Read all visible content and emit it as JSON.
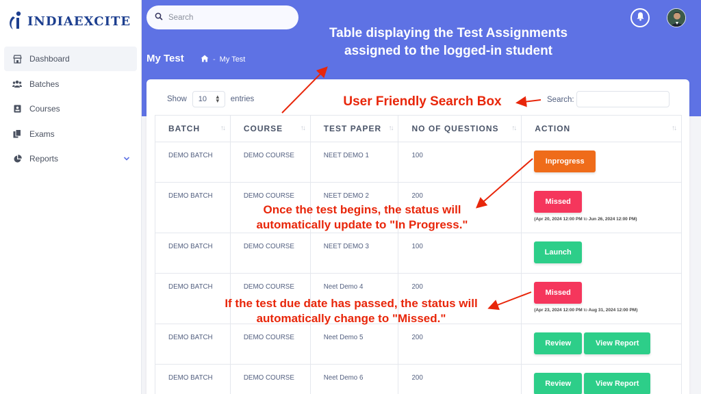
{
  "brand": {
    "name": "INDIAEXCITE"
  },
  "sidebar": {
    "items": [
      {
        "label": "Dashboard",
        "icon": "store-icon"
      },
      {
        "label": "Batches",
        "icon": "users-icon"
      },
      {
        "label": "Courses",
        "icon": "contact-card-icon"
      },
      {
        "label": "Exams",
        "icon": "copy-icon"
      },
      {
        "label": "Reports",
        "icon": "pie-chart-icon"
      }
    ]
  },
  "header": {
    "search_placeholder": "Search",
    "page_title": "My Test",
    "breadcrumb_current": "My Test"
  },
  "table_controls": {
    "show_label": "Show",
    "entries_value": "10",
    "entries_label": "entries",
    "search_label": "Search:"
  },
  "table": {
    "columns": [
      "BATCH",
      "COURSE",
      "TEST PAPER",
      "NO OF QUESTIONS",
      "ACTION"
    ],
    "rows": [
      {
        "batch": "DEMO BATCH",
        "course": "DEMO COURSE",
        "paper": "NEET DEMO 1",
        "questions": "100",
        "actions": [
          "Inprogress"
        ],
        "dates": null
      },
      {
        "batch": "DEMO BATCH",
        "course": "DEMO COURSE",
        "paper": "NEET DEMO 2",
        "questions": "200",
        "actions": [
          "Missed"
        ],
        "dates": {
          "from": "(Apr 20, 2024 12:00 PM",
          "to_word": "to",
          "to": "Jun 26, 2024 12:00 PM)"
        }
      },
      {
        "batch": "DEMO BATCH",
        "course": "DEMO COURSE",
        "paper": "NEET DEMO 3",
        "questions": "100",
        "actions": [
          "Launch"
        ],
        "dates": null
      },
      {
        "batch": "DEMO BATCH",
        "course": "DEMO COURSE",
        "paper": "Neet Demo 4",
        "questions": "200",
        "actions": [
          "Missed"
        ],
        "dates": {
          "from": "(Apr 23, 2024 12:00 PM",
          "to_word": "to",
          "to": "Aug 31, 2024 12:00 PM)"
        }
      },
      {
        "batch": "DEMO BATCH",
        "course": "DEMO COURSE",
        "paper": "Neet Demo 5",
        "questions": "200",
        "actions": [
          "Review",
          "View Report"
        ],
        "dates": null
      },
      {
        "batch": "DEMO BATCH",
        "course": "DEMO COURSE",
        "paper": "Neet Demo 6",
        "questions": "200",
        "actions": [
          "Review",
          "View Report"
        ],
        "dates": null
      }
    ]
  },
  "annotations": {
    "table_line1": "Table displaying the Test Assignments",
    "table_line2": "assigned to the logged-in student",
    "search_box": "User Friendly Search Box",
    "inprogress_line1": "Once the test begins, the status will",
    "inprogress_line2": "automatically update to \"In Progress.\"",
    "missed_line1": "If the test due date has passed, the status will",
    "missed_line2": "automatically change to \"Missed.\""
  },
  "colors": {
    "header_band": "#5e72e4",
    "inprogress": "#ef6c1a",
    "missed": "#f5365c",
    "success": "#2dce89",
    "annotation_red": "#e8260a",
    "brand_blue": "#1d3f8f"
  }
}
